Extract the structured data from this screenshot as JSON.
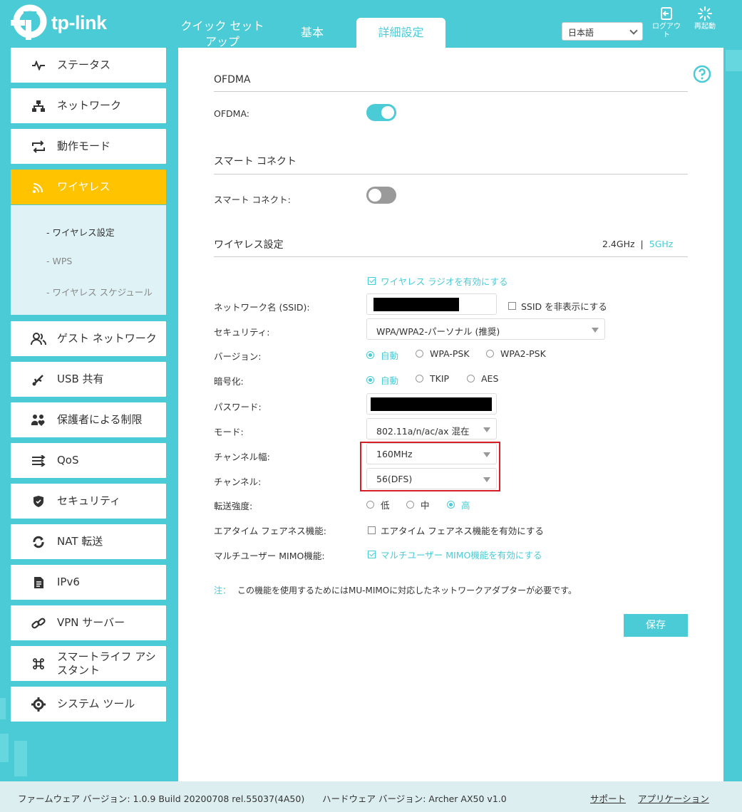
{
  "header": {
    "logo_text": "tp-link",
    "tabs": [
      {
        "label": "クイック セット\nアップ"
      },
      {
        "label": "基本"
      },
      {
        "label": "詳細設定"
      }
    ],
    "language": "日本語",
    "logout_label": "ログアウト",
    "reboot_label": "再起動"
  },
  "sidebar": {
    "items": [
      {
        "label": "ステータス",
        "icon": "pulse-icon"
      },
      {
        "label": "ネットワーク",
        "icon": "network-icon"
      },
      {
        "label": "動作モード",
        "icon": "swap-icon"
      },
      {
        "label": "ワイヤレス",
        "icon": "wifi-icon"
      },
      {
        "label": "ゲスト ネットワーク",
        "icon": "users-icon"
      },
      {
        "label": "USB 共有",
        "icon": "usb-icon"
      },
      {
        "label": "保護者による制限",
        "icon": "family-icon"
      },
      {
        "label": "QoS",
        "icon": "qos-icon"
      },
      {
        "label": "セキュリティ",
        "icon": "shield-icon"
      },
      {
        "label": "NAT 転送",
        "icon": "nat-icon"
      },
      {
        "label": "IPv6",
        "icon": "ipv6-icon"
      },
      {
        "label": "VPN サーバー",
        "icon": "link-icon"
      },
      {
        "label": "スマートライフ アシスタント",
        "icon": "command-icon"
      },
      {
        "label": "システム ツール",
        "icon": "gear-icon"
      }
    ],
    "subitems": [
      {
        "label": "- ワイヤレス設定"
      },
      {
        "label": "- WPS"
      },
      {
        "label": "- ワイヤレス スケジュール"
      }
    ]
  },
  "main": {
    "ofdma": {
      "title": "OFDMA",
      "label": "OFDMA:",
      "enabled": true
    },
    "smart_connect": {
      "title": "スマート コネクト",
      "label": "スマート コネクト:",
      "enabled": false
    },
    "wireless": {
      "title": "ワイヤレス設定",
      "band_24": "2.4GHz",
      "band_sep": "|",
      "band_5": "5GHz",
      "enable_radio": "ワイヤレス ラジオを有効にする",
      "ssid_label": "ネットワーク名 (SSID):",
      "hide_ssid": "SSID を非表示にする",
      "security_label": "セキュリティ:",
      "security_value": "WPA/WPA2-パーソナル (推奨)",
      "version_label": "バージョン:",
      "version_options": [
        "自動",
        "WPA-PSK",
        "WPA2-PSK"
      ],
      "encryption_label": "暗号化:",
      "encryption_options": [
        "自動",
        "TKIP",
        "AES"
      ],
      "password_label": "パスワード:",
      "mode_label": "モード:",
      "mode_value": "802.11a/n/ac/ax 混在",
      "width_label": "チャンネル幅:",
      "width_value": "160MHz",
      "channel_label": "チャンネル:",
      "channel_value": "56(DFS)",
      "power_label": "転送強度:",
      "power_options": [
        "低",
        "中",
        "高"
      ],
      "airtime_label": "エアタイム フェアネス機能:",
      "airtime_option": "エアタイム フェアネス機能を有効にする",
      "mimo_label": "マルチユーザー MIMO機能:",
      "mimo_option": "マルチユーザー MIMO機能を有効にする"
    },
    "note_label": "注：",
    "note_text": "この機能を使用するためにはMU-MIMOに対応したネットワークアダプターが必要です。",
    "save_label": "保存"
  },
  "footer": {
    "firmware": "ファームウェア バージョン: 1.0.9 Build 20200708 rel.55037(4A50)",
    "hardware": "ハードウェア バージョン: Archer AX50 v1.0",
    "support": "サポート",
    "app": "アプリケーション"
  },
  "colors": {
    "accent": "#4acbd6",
    "active": "#ffc300",
    "highlight": "#d81e25"
  }
}
